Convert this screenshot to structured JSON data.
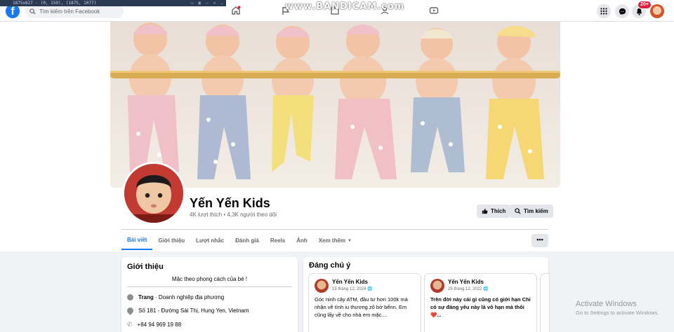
{
  "recorder": {
    "bar_text": "1875x827 - (0, 150), (1875, 1077)",
    "watermark": "www.BANDICAM.com"
  },
  "nav": {
    "search_placeholder": "Tìm kiếm trên Facebook",
    "notification_count": "20+",
    "brand_color": "#1877f2"
  },
  "page": {
    "name": "Yến Yến Kids",
    "stats": "4K lượt thích • 4,3K người theo dõi",
    "like_label": "Thích",
    "search_label": "Tìm kiếm"
  },
  "tabs": [
    {
      "label": "Bài viết",
      "active": true
    },
    {
      "label": "Giới thiệu"
    },
    {
      "label": "Lượt nhắc"
    },
    {
      "label": "Đánh giá"
    },
    {
      "label": "Reels"
    },
    {
      "label": "Ảnh"
    },
    {
      "label": "Xem thêm"
    }
  ],
  "more_label": "•••",
  "intro": {
    "title": "Giới thiệu",
    "bio": "Mặc theo phong cách của bé !",
    "category_prefix": "Trang",
    "category": " · Doanh nghiệp địa phương",
    "address": "Số 181 - Đường Sài Thị, Hung Yen, Vietnam",
    "phone": "+84 94 969 19 88"
  },
  "featured": {
    "title": "Đáng chú ý",
    "posts": [
      {
        "author": "Yến Yến Kids",
        "date": "15 tháng 12, 2024",
        "text": "Góc ninh cây ATM, đầu tư hơn 100k mà nhận về tình iu thương zô bờ bếnn. Em cũng lấy về cho nhà em mặc...."
      },
      {
        "author": "Yến Yến Kids",
        "date": "25 tháng 12, 2022",
        "text": "Trên đời này cái gì cũng có giới hạn Chỉ có sự đáng yêu này là vô hạn mà thôi ❤️..."
      }
    ]
  },
  "windows": {
    "activate_title": "Activate Windows",
    "activate_sub": "Go to Settings to activate Windows."
  }
}
